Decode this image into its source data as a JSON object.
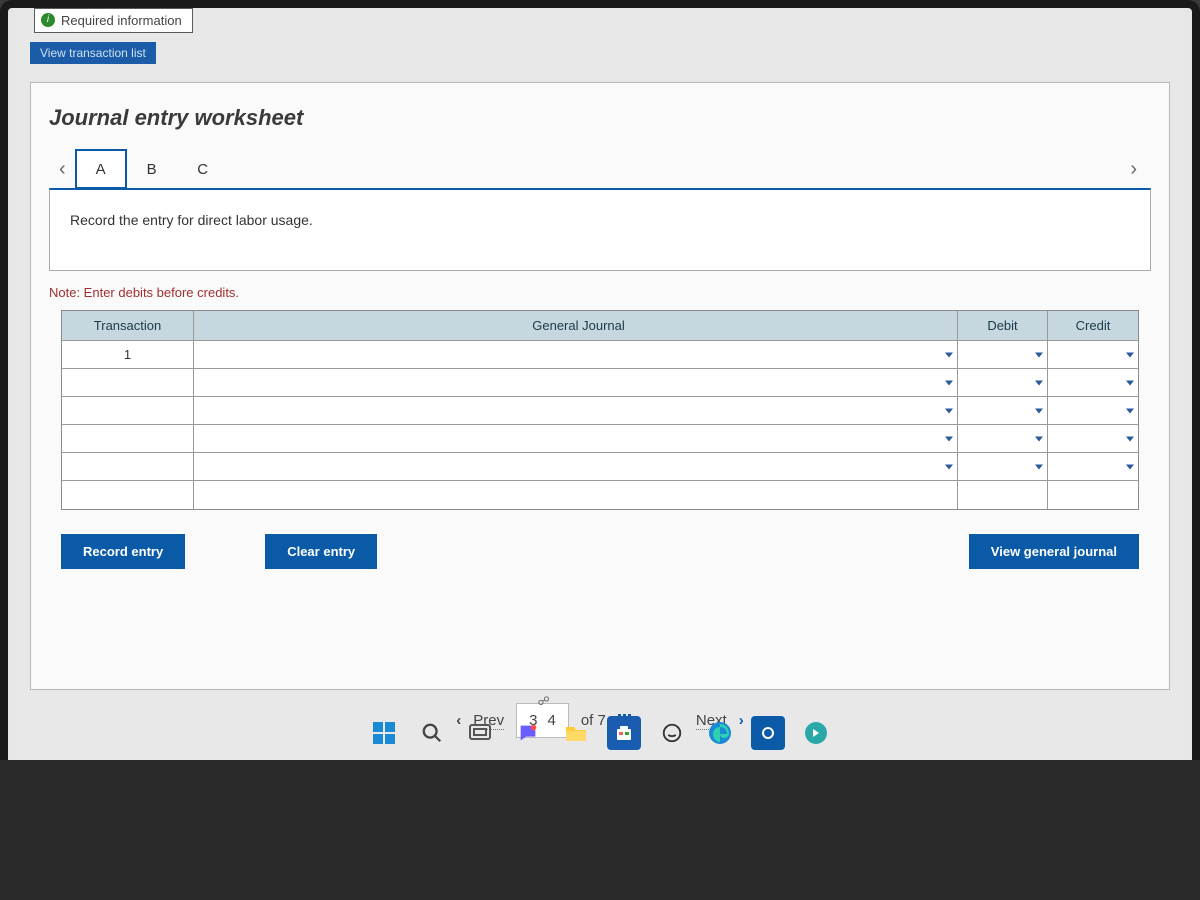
{
  "topbar": {
    "required_info": "Required information",
    "view_list": "View transaction list"
  },
  "worksheet": {
    "title": "Journal entry worksheet",
    "tabs": {
      "a": "A",
      "b": "B",
      "c": "C"
    },
    "instruction": "Record the entry for direct labor usage.",
    "note": "Note: Enter debits before credits.",
    "headers": {
      "transaction": "Transaction",
      "general_journal": "General Journal",
      "debit": "Debit",
      "credit": "Credit"
    },
    "row1_tx": "1",
    "buttons": {
      "record": "Record entry",
      "clear": "Clear entry",
      "view": "View general journal"
    }
  },
  "pager": {
    "prev": "Prev",
    "current": "3",
    "next_page": "4",
    "of": "of 7",
    "next": "Next"
  }
}
